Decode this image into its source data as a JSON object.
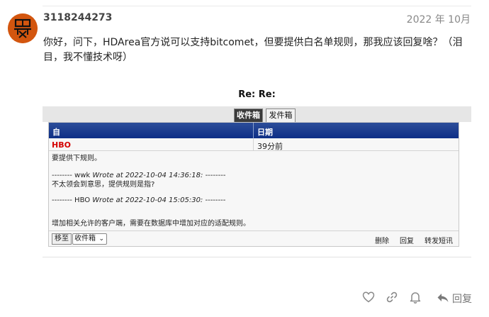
{
  "post": {
    "username": "3118244273",
    "date": "2022 年 10月",
    "text": "你好，问下，HDArea官方说可以支持bitcomet，但要提供白名单规则，那我应该回复啥？（泪目，我不懂技术呀）"
  },
  "embed": {
    "title": "Re: Re:",
    "tabs": [
      {
        "label": "收件箱",
        "active": true
      },
      {
        "label": "发件箱",
        "active": false
      }
    ],
    "table": {
      "col_from": "自",
      "col_date": "日期",
      "sender": "HBO",
      "time": "39分前"
    },
    "message_lines": [
      "要提供下规则。",
      "-------- wwk",
      " Wrote at 2022-10-04 14:36:18: ",
      "--------",
      "不太领会到意思，提供规则是指?",
      "-------- HBO",
      " Wrote at 2022-10-04 15:05:30: ",
      "--------",
      "增加相关允许的客户端，需要在数据库中增加对应的适配规则。"
    ],
    "footer": {
      "move_button": "移至",
      "folder_select": "收件箱",
      "delete": "删除",
      "reply": "回复",
      "forward": "转发短讯"
    }
  },
  "actions": {
    "reply_label": "回复",
    "icons": [
      "heart-icon",
      "link-icon",
      "bell-icon",
      "reply-icon"
    ]
  },
  "colors": {
    "avatar_bg": "#d3560f",
    "header_blue": "#0e2f86",
    "sender_red": "#d40000"
  }
}
